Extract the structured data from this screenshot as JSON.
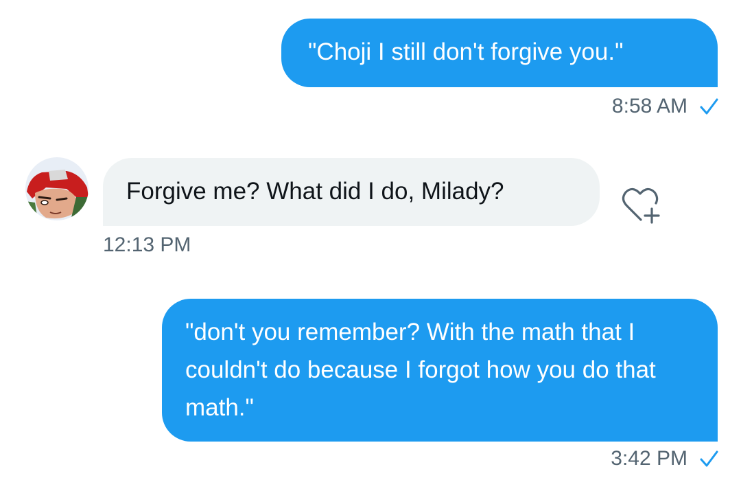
{
  "conversation": {
    "messages": [
      {
        "direction": "outgoing",
        "text": "\"Choji I still don't forgive you.\"",
        "time": "8:58 AM",
        "status_icon": "check-icon"
      },
      {
        "direction": "incoming",
        "text": "Forgive me? What did I do, Milady?",
        "time": "12:13 PM",
        "avatar_icon": "avatar-anime-character",
        "reaction_icon": "heart-plus-icon"
      },
      {
        "direction": "outgoing",
        "text": "\"don't you remember? With the math that I couldn't do because I forgot how you do that math.\"",
        "time": "3:42 PM",
        "status_icon": "check-icon"
      }
    ]
  },
  "colors": {
    "outgoing_bubble": "#1d9bf0",
    "incoming_bubble": "#eff3f4",
    "timestamp": "#536471",
    "check": "#1d9bf0"
  }
}
